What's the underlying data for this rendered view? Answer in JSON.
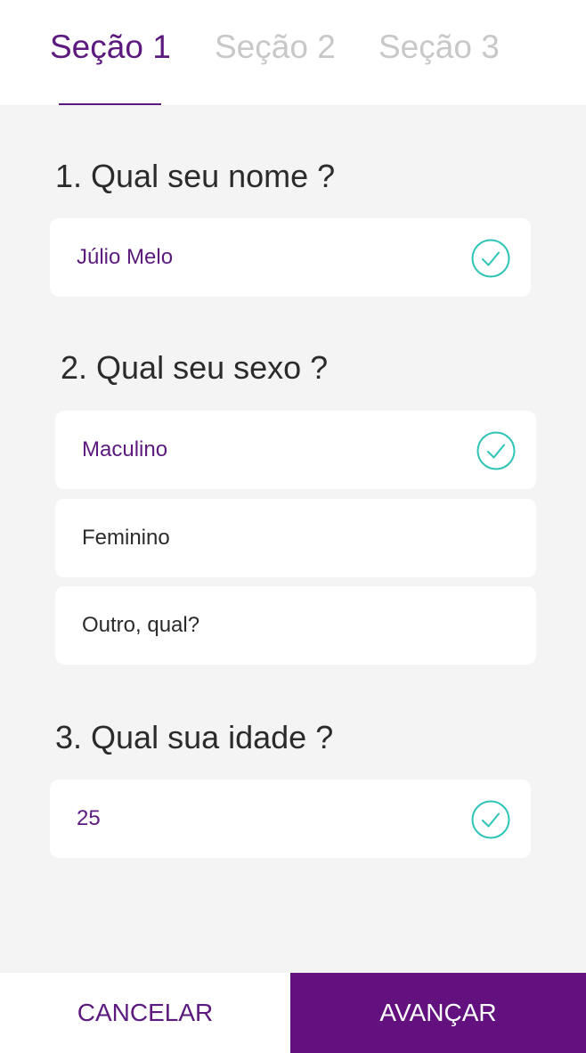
{
  "tabs": [
    {
      "label": "Seção 1",
      "active": true
    },
    {
      "label": "Seção 2",
      "active": false
    },
    {
      "label": "Seção 3",
      "active": false
    }
  ],
  "questions": [
    {
      "title": "1. Qual seu nome ?",
      "options": [
        {
          "label": "Júlio Melo",
          "selected": true
        }
      ]
    },
    {
      "title": "2. Qual seu sexo ?",
      "options": [
        {
          "label": "Maculino",
          "selected": true
        },
        {
          "label": "Feminino",
          "selected": false
        },
        {
          "label": "Outro, qual?",
          "selected": false
        }
      ]
    },
    {
      "title": "3. Qual sua idade ?",
      "options": [
        {
          "label": "25",
          "selected": true
        }
      ]
    }
  ],
  "footer": {
    "cancel_label": "CANCELAR",
    "next_label": "AVANÇAR"
  },
  "colors": {
    "brand": "#62117f",
    "check": "#2ec4b6",
    "background": "#f4f4f4"
  },
  "icons": {
    "check": "check-circle-icon"
  }
}
